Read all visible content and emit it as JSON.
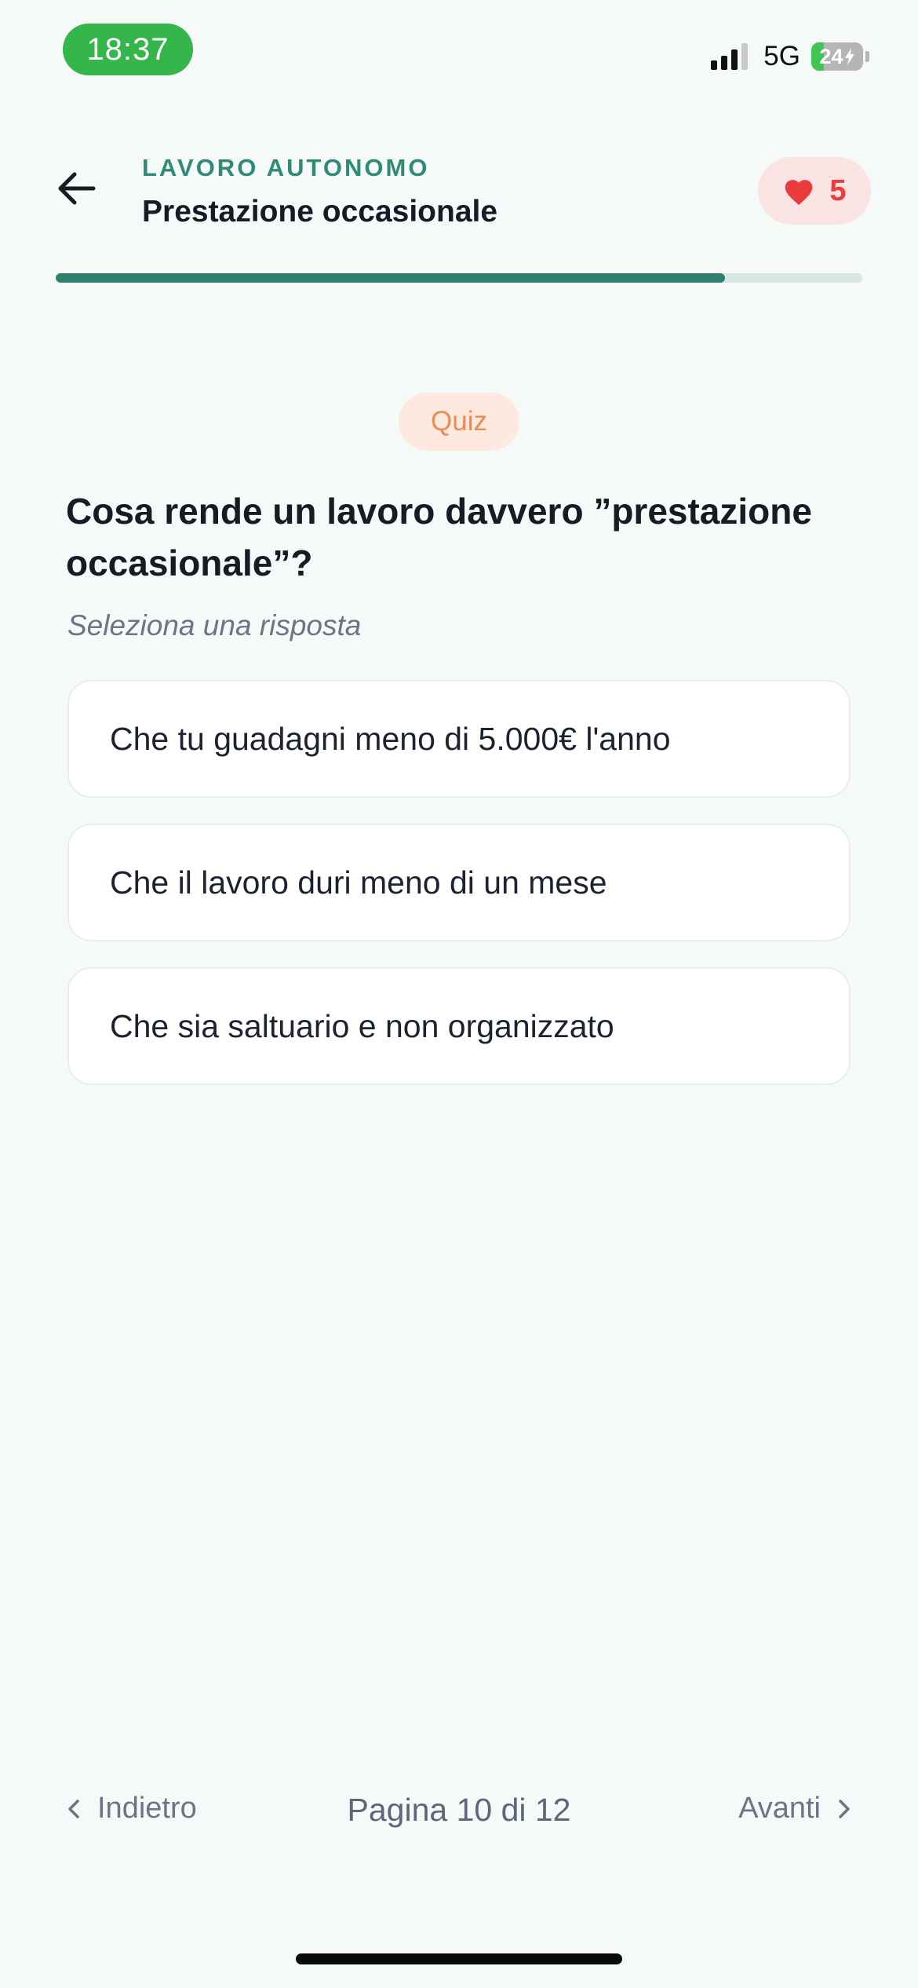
{
  "status_bar": {
    "time": "18:37",
    "network": "5G",
    "battery": "24"
  },
  "header": {
    "category": "LAVORO AUTONOMO",
    "title": "Prestazione occasionale",
    "lives": "5"
  },
  "progress": {
    "fraction": 0.83
  },
  "quiz": {
    "badge": "Quiz",
    "question": "Cosa rende un lavoro davvero ”prestazione occasionale”?",
    "hint": "Seleziona una risposta",
    "answers": [
      "Che tu guadagni meno di 5.000€ l'anno",
      "Che il lavoro duri meno di un mese",
      "Che sia saltuario e non organizzato"
    ]
  },
  "footer": {
    "prev_label": "Indietro",
    "page_label": "Pagina 10 di 12",
    "next_label": "Avanti"
  },
  "colors": {
    "accent": "#2f7f6f",
    "heart": "#ea3c3c",
    "quiz_badge": "#f08a55"
  }
}
